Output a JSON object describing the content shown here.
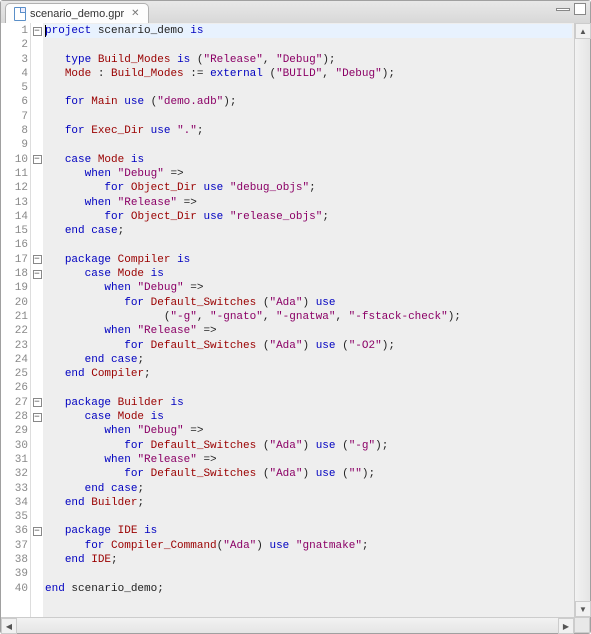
{
  "tab": {
    "filename": "scenario_demo.gpr",
    "close_glyph": "✕"
  },
  "fold_lines": [
    1,
    10,
    17,
    18,
    27,
    28,
    36
  ],
  "code_lines": [
    {
      "n": 1,
      "current": true,
      "tokens": [
        {
          "t": "caret"
        },
        {
          "t": "kw",
          "v": "project"
        },
        {
          "t": "plain",
          "v": " scenario_demo "
        },
        {
          "t": "kw",
          "v": "is"
        }
      ]
    },
    {
      "n": 2,
      "tokens": []
    },
    {
      "n": 3,
      "tokens": [
        {
          "t": "plain",
          "v": "   "
        },
        {
          "t": "kw",
          "v": "type"
        },
        {
          "t": "plain",
          "v": " "
        },
        {
          "t": "ident",
          "v": "Build_Modes"
        },
        {
          "t": "plain",
          "v": " "
        },
        {
          "t": "kw",
          "v": "is"
        },
        {
          "t": "plain",
          "v": " ("
        },
        {
          "t": "str",
          "v": "\"Release\""
        },
        {
          "t": "plain",
          "v": ", "
        },
        {
          "t": "str",
          "v": "\"Debug\""
        },
        {
          "t": "plain",
          "v": ");"
        }
      ]
    },
    {
      "n": 4,
      "tokens": [
        {
          "t": "plain",
          "v": "   "
        },
        {
          "t": "ident",
          "v": "Mode"
        },
        {
          "t": "plain",
          "v": " : "
        },
        {
          "t": "ident",
          "v": "Build_Modes"
        },
        {
          "t": "plain",
          "v": " := "
        },
        {
          "t": "kw",
          "v": "external"
        },
        {
          "t": "plain",
          "v": " ("
        },
        {
          "t": "str",
          "v": "\"BUILD\""
        },
        {
          "t": "plain",
          "v": ", "
        },
        {
          "t": "str",
          "v": "\"Debug\""
        },
        {
          "t": "plain",
          "v": ");"
        }
      ]
    },
    {
      "n": 5,
      "tokens": []
    },
    {
      "n": 6,
      "tokens": [
        {
          "t": "plain",
          "v": "   "
        },
        {
          "t": "kw",
          "v": "for"
        },
        {
          "t": "plain",
          "v": " "
        },
        {
          "t": "ident",
          "v": "Main"
        },
        {
          "t": "plain",
          "v": " "
        },
        {
          "t": "kw",
          "v": "use"
        },
        {
          "t": "plain",
          "v": " ("
        },
        {
          "t": "str",
          "v": "\"demo.adb\""
        },
        {
          "t": "plain",
          "v": ");"
        }
      ]
    },
    {
      "n": 7,
      "tokens": []
    },
    {
      "n": 8,
      "tokens": [
        {
          "t": "plain",
          "v": "   "
        },
        {
          "t": "kw",
          "v": "for"
        },
        {
          "t": "plain",
          "v": " "
        },
        {
          "t": "ident",
          "v": "Exec_Dir"
        },
        {
          "t": "plain",
          "v": " "
        },
        {
          "t": "kw",
          "v": "use"
        },
        {
          "t": "plain",
          "v": " "
        },
        {
          "t": "str",
          "v": "\".\""
        },
        {
          "t": "plain",
          "v": ";"
        }
      ]
    },
    {
      "n": 9,
      "tokens": []
    },
    {
      "n": 10,
      "tokens": [
        {
          "t": "plain",
          "v": "   "
        },
        {
          "t": "kw",
          "v": "case"
        },
        {
          "t": "plain",
          "v": " "
        },
        {
          "t": "ident",
          "v": "Mode"
        },
        {
          "t": "plain",
          "v": " "
        },
        {
          "t": "kw",
          "v": "is"
        }
      ]
    },
    {
      "n": 11,
      "tokens": [
        {
          "t": "plain",
          "v": "      "
        },
        {
          "t": "kw",
          "v": "when"
        },
        {
          "t": "plain",
          "v": " "
        },
        {
          "t": "str",
          "v": "\"Debug\""
        },
        {
          "t": "plain",
          "v": " =>"
        }
      ]
    },
    {
      "n": 12,
      "tokens": [
        {
          "t": "plain",
          "v": "         "
        },
        {
          "t": "kw",
          "v": "for"
        },
        {
          "t": "plain",
          "v": " "
        },
        {
          "t": "ident",
          "v": "Object_Dir"
        },
        {
          "t": "plain",
          "v": " "
        },
        {
          "t": "kw",
          "v": "use"
        },
        {
          "t": "plain",
          "v": " "
        },
        {
          "t": "str",
          "v": "\"debug_objs\""
        },
        {
          "t": "plain",
          "v": ";"
        }
      ]
    },
    {
      "n": 13,
      "tokens": [
        {
          "t": "plain",
          "v": "      "
        },
        {
          "t": "kw",
          "v": "when"
        },
        {
          "t": "plain",
          "v": " "
        },
        {
          "t": "str",
          "v": "\"Release\""
        },
        {
          "t": "plain",
          "v": " =>"
        }
      ]
    },
    {
      "n": 14,
      "tokens": [
        {
          "t": "plain",
          "v": "         "
        },
        {
          "t": "kw",
          "v": "for"
        },
        {
          "t": "plain",
          "v": " "
        },
        {
          "t": "ident",
          "v": "Object_Dir"
        },
        {
          "t": "plain",
          "v": " "
        },
        {
          "t": "kw",
          "v": "use"
        },
        {
          "t": "plain",
          "v": " "
        },
        {
          "t": "str",
          "v": "\"release_objs\""
        },
        {
          "t": "plain",
          "v": ";"
        }
      ]
    },
    {
      "n": 15,
      "tokens": [
        {
          "t": "plain",
          "v": "   "
        },
        {
          "t": "kw",
          "v": "end"
        },
        {
          "t": "plain",
          "v": " "
        },
        {
          "t": "kw",
          "v": "case"
        },
        {
          "t": "plain",
          "v": ";"
        }
      ]
    },
    {
      "n": 16,
      "tokens": []
    },
    {
      "n": 17,
      "tokens": [
        {
          "t": "plain",
          "v": "   "
        },
        {
          "t": "kw",
          "v": "package"
        },
        {
          "t": "plain",
          "v": " "
        },
        {
          "t": "ident",
          "v": "Compiler"
        },
        {
          "t": "plain",
          "v": " "
        },
        {
          "t": "kw",
          "v": "is"
        }
      ]
    },
    {
      "n": 18,
      "tokens": [
        {
          "t": "plain",
          "v": "      "
        },
        {
          "t": "kw",
          "v": "case"
        },
        {
          "t": "plain",
          "v": " "
        },
        {
          "t": "ident",
          "v": "Mode"
        },
        {
          "t": "plain",
          "v": " "
        },
        {
          "t": "kw",
          "v": "is"
        }
      ]
    },
    {
      "n": 19,
      "tokens": [
        {
          "t": "plain",
          "v": "         "
        },
        {
          "t": "kw",
          "v": "when"
        },
        {
          "t": "plain",
          "v": " "
        },
        {
          "t": "str",
          "v": "\"Debug\""
        },
        {
          "t": "plain",
          "v": " =>"
        }
      ]
    },
    {
      "n": 20,
      "tokens": [
        {
          "t": "plain",
          "v": "            "
        },
        {
          "t": "kw",
          "v": "for"
        },
        {
          "t": "plain",
          "v": " "
        },
        {
          "t": "ident",
          "v": "Default_Switches"
        },
        {
          "t": "plain",
          "v": " ("
        },
        {
          "t": "str",
          "v": "\"Ada\""
        },
        {
          "t": "plain",
          "v": ") "
        },
        {
          "t": "kw",
          "v": "use"
        }
      ]
    },
    {
      "n": 21,
      "tokens": [
        {
          "t": "plain",
          "v": "                  ("
        },
        {
          "t": "str",
          "v": "\"-g\""
        },
        {
          "t": "plain",
          "v": ", "
        },
        {
          "t": "str",
          "v": "\"-gnato\""
        },
        {
          "t": "plain",
          "v": ", "
        },
        {
          "t": "str",
          "v": "\"-gnatwa\""
        },
        {
          "t": "plain",
          "v": ", "
        },
        {
          "t": "str",
          "v": "\"-fstack-check\""
        },
        {
          "t": "plain",
          "v": ");"
        }
      ]
    },
    {
      "n": 22,
      "tokens": [
        {
          "t": "plain",
          "v": "         "
        },
        {
          "t": "kw",
          "v": "when"
        },
        {
          "t": "plain",
          "v": " "
        },
        {
          "t": "str",
          "v": "\"Release\""
        },
        {
          "t": "plain",
          "v": " =>"
        }
      ]
    },
    {
      "n": 23,
      "tokens": [
        {
          "t": "plain",
          "v": "            "
        },
        {
          "t": "kw",
          "v": "for"
        },
        {
          "t": "plain",
          "v": " "
        },
        {
          "t": "ident",
          "v": "Default_Switches"
        },
        {
          "t": "plain",
          "v": " ("
        },
        {
          "t": "str",
          "v": "\"Ada\""
        },
        {
          "t": "plain",
          "v": ") "
        },
        {
          "t": "kw",
          "v": "use"
        },
        {
          "t": "plain",
          "v": " ("
        },
        {
          "t": "str",
          "v": "\"-O2\""
        },
        {
          "t": "plain",
          "v": ");"
        }
      ]
    },
    {
      "n": 24,
      "tokens": [
        {
          "t": "plain",
          "v": "      "
        },
        {
          "t": "kw",
          "v": "end"
        },
        {
          "t": "plain",
          "v": " "
        },
        {
          "t": "kw",
          "v": "case"
        },
        {
          "t": "plain",
          "v": ";"
        }
      ]
    },
    {
      "n": 25,
      "tokens": [
        {
          "t": "plain",
          "v": "   "
        },
        {
          "t": "kw",
          "v": "end"
        },
        {
          "t": "plain",
          "v": " "
        },
        {
          "t": "ident",
          "v": "Compiler"
        },
        {
          "t": "plain",
          "v": ";"
        }
      ]
    },
    {
      "n": 26,
      "tokens": []
    },
    {
      "n": 27,
      "tokens": [
        {
          "t": "plain",
          "v": "   "
        },
        {
          "t": "kw",
          "v": "package"
        },
        {
          "t": "plain",
          "v": " "
        },
        {
          "t": "ident",
          "v": "Builder"
        },
        {
          "t": "plain",
          "v": " "
        },
        {
          "t": "kw",
          "v": "is"
        }
      ]
    },
    {
      "n": 28,
      "tokens": [
        {
          "t": "plain",
          "v": "      "
        },
        {
          "t": "kw",
          "v": "case"
        },
        {
          "t": "plain",
          "v": " "
        },
        {
          "t": "ident",
          "v": "Mode"
        },
        {
          "t": "plain",
          "v": " "
        },
        {
          "t": "kw",
          "v": "is"
        }
      ]
    },
    {
      "n": 29,
      "tokens": [
        {
          "t": "plain",
          "v": "         "
        },
        {
          "t": "kw",
          "v": "when"
        },
        {
          "t": "plain",
          "v": " "
        },
        {
          "t": "str",
          "v": "\"Debug\""
        },
        {
          "t": "plain",
          "v": " =>"
        }
      ]
    },
    {
      "n": 30,
      "tokens": [
        {
          "t": "plain",
          "v": "            "
        },
        {
          "t": "kw",
          "v": "for"
        },
        {
          "t": "plain",
          "v": " "
        },
        {
          "t": "ident",
          "v": "Default_Switches"
        },
        {
          "t": "plain",
          "v": " ("
        },
        {
          "t": "str",
          "v": "\"Ada\""
        },
        {
          "t": "plain",
          "v": ") "
        },
        {
          "t": "kw",
          "v": "use"
        },
        {
          "t": "plain",
          "v": " ("
        },
        {
          "t": "str",
          "v": "\"-g\""
        },
        {
          "t": "plain",
          "v": ");"
        }
      ]
    },
    {
      "n": 31,
      "tokens": [
        {
          "t": "plain",
          "v": "         "
        },
        {
          "t": "kw",
          "v": "when"
        },
        {
          "t": "plain",
          "v": " "
        },
        {
          "t": "str",
          "v": "\"Release\""
        },
        {
          "t": "plain",
          "v": " =>"
        }
      ]
    },
    {
      "n": 32,
      "tokens": [
        {
          "t": "plain",
          "v": "            "
        },
        {
          "t": "kw",
          "v": "for"
        },
        {
          "t": "plain",
          "v": " "
        },
        {
          "t": "ident",
          "v": "Default_Switches"
        },
        {
          "t": "plain",
          "v": " ("
        },
        {
          "t": "str",
          "v": "\"Ada\""
        },
        {
          "t": "plain",
          "v": ") "
        },
        {
          "t": "kw",
          "v": "use"
        },
        {
          "t": "plain",
          "v": " ("
        },
        {
          "t": "str",
          "v": "\"\""
        },
        {
          "t": "plain",
          "v": ");"
        }
      ]
    },
    {
      "n": 33,
      "tokens": [
        {
          "t": "plain",
          "v": "      "
        },
        {
          "t": "kw",
          "v": "end"
        },
        {
          "t": "plain",
          "v": " "
        },
        {
          "t": "kw",
          "v": "case"
        },
        {
          "t": "plain",
          "v": ";"
        }
      ]
    },
    {
      "n": 34,
      "tokens": [
        {
          "t": "plain",
          "v": "   "
        },
        {
          "t": "kw",
          "v": "end"
        },
        {
          "t": "plain",
          "v": " "
        },
        {
          "t": "ident",
          "v": "Builder"
        },
        {
          "t": "plain",
          "v": ";"
        }
      ]
    },
    {
      "n": 35,
      "tokens": []
    },
    {
      "n": 36,
      "tokens": [
        {
          "t": "plain",
          "v": "   "
        },
        {
          "t": "kw",
          "v": "package"
        },
        {
          "t": "plain",
          "v": " "
        },
        {
          "t": "ident",
          "v": "IDE"
        },
        {
          "t": "plain",
          "v": " "
        },
        {
          "t": "kw",
          "v": "is"
        }
      ]
    },
    {
      "n": 37,
      "tokens": [
        {
          "t": "plain",
          "v": "      "
        },
        {
          "t": "kw",
          "v": "for"
        },
        {
          "t": "plain",
          "v": " "
        },
        {
          "t": "ident",
          "v": "Compiler_Command"
        },
        {
          "t": "plain",
          "v": "("
        },
        {
          "t": "str",
          "v": "\"Ada\""
        },
        {
          "t": "plain",
          "v": ") "
        },
        {
          "t": "kw",
          "v": "use"
        },
        {
          "t": "plain",
          "v": " "
        },
        {
          "t": "str",
          "v": "\"gnatmake\""
        },
        {
          "t": "plain",
          "v": ";"
        }
      ]
    },
    {
      "n": 38,
      "tokens": [
        {
          "t": "plain",
          "v": "   "
        },
        {
          "t": "kw",
          "v": "end"
        },
        {
          "t": "plain",
          "v": " "
        },
        {
          "t": "ident",
          "v": "IDE"
        },
        {
          "t": "plain",
          "v": ";"
        }
      ]
    },
    {
      "n": 39,
      "tokens": []
    },
    {
      "n": 40,
      "tokens": [
        {
          "t": "kw",
          "v": "end"
        },
        {
          "t": "plain",
          "v": " scenario_demo;"
        }
      ]
    }
  ]
}
